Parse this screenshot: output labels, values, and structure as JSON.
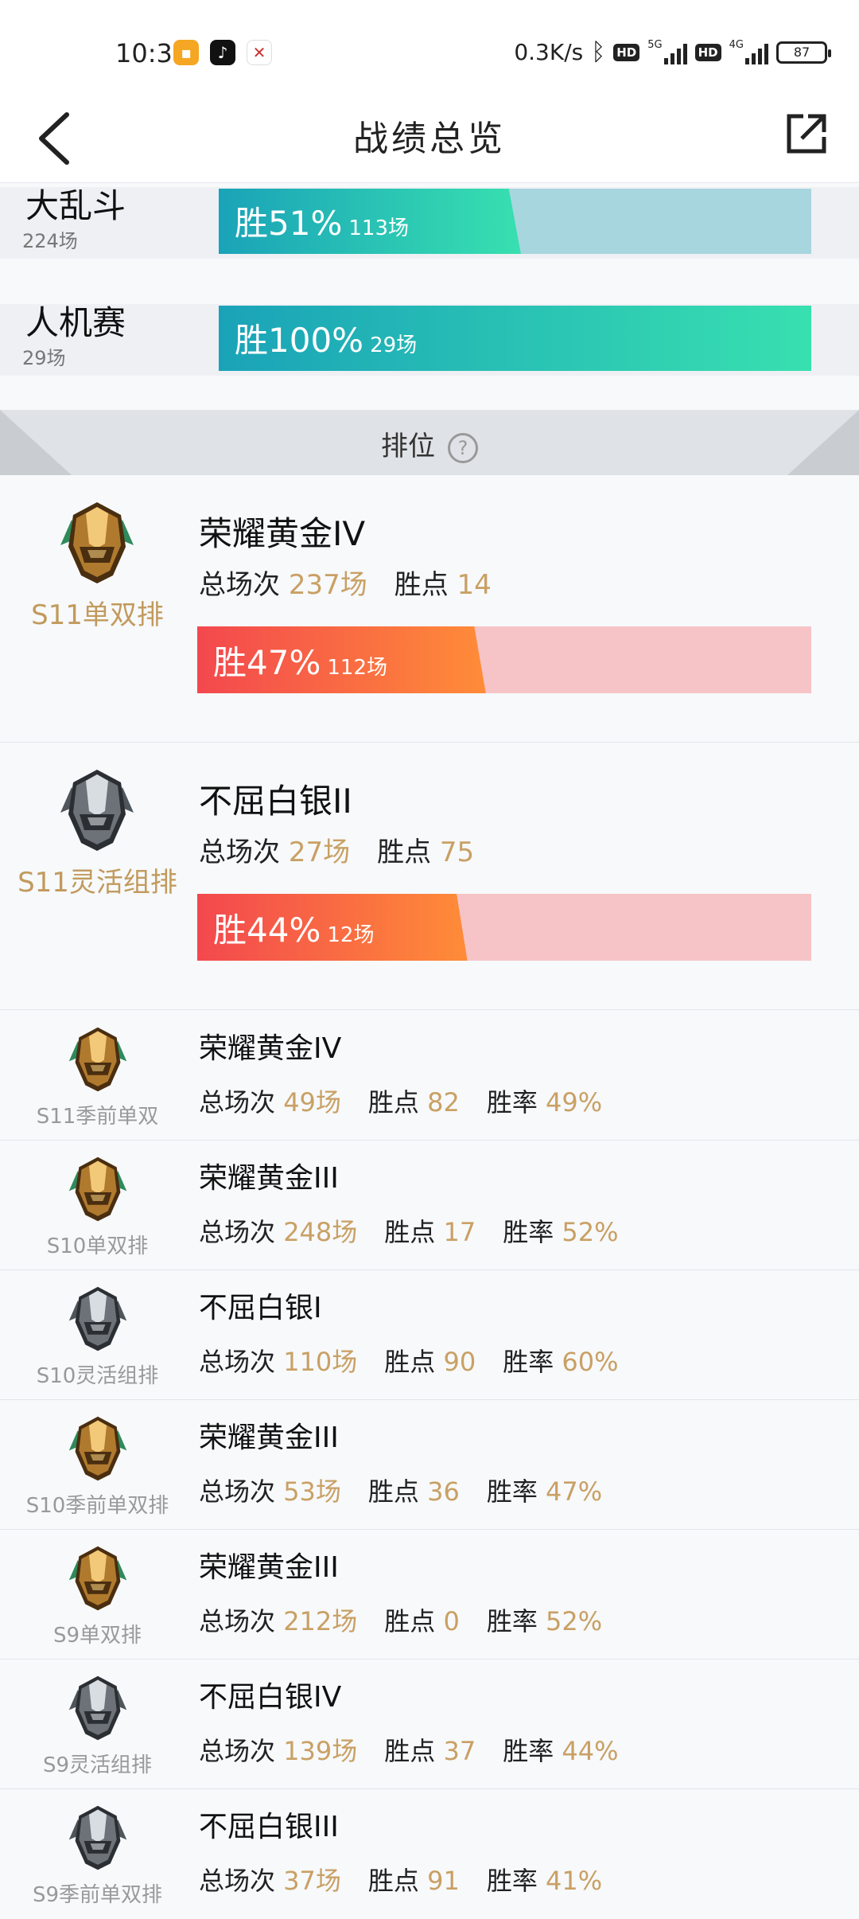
{
  "status_bar": {
    "time": "10:39",
    "network_speed": "0.3K/s",
    "hd1": "HD",
    "hd2": "HD",
    "sig1_label": "5G",
    "sig2_label": "4G",
    "battery": "87"
  },
  "nav": {
    "title": "战绩总览"
  },
  "modes": [
    {
      "name": "大乱斗",
      "count": "224场",
      "win_text": "胜51%",
      "win_games": "113场",
      "win_rate": 0.51
    },
    {
      "name": "人机赛",
      "count": "29场",
      "win_text": "胜100%",
      "win_games": "29场",
      "win_rate": 1.0
    }
  ],
  "rank_header": {
    "label": "排位",
    "help": "?"
  },
  "big_ranks": [
    {
      "season": "S11单双排",
      "tier": "荣耀黄金IV",
      "total_label": "总场次",
      "total": "237场",
      "points_label": "胜点",
      "points": "14",
      "win_text": "胜47%",
      "win_games": "112场",
      "win_rate": 0.47,
      "emblem": "gold"
    },
    {
      "season": "S11灵活组排",
      "tier": "不屈白银II",
      "total_label": "总场次",
      "total": "27场",
      "points_label": "胜点",
      "points": "75",
      "win_text": "胜44%",
      "win_games": "12场",
      "win_rate": 0.44,
      "emblem": "silver"
    }
  ],
  "small_ranks": [
    {
      "season": "S11季前单双",
      "tier": "荣耀黄金IV",
      "total_label": "总场次",
      "total": "49场",
      "points_label": "胜点",
      "points": "82",
      "rate_label": "胜率",
      "rate": "49%",
      "emblem": "gold"
    },
    {
      "season": "S10单双排",
      "tier": "荣耀黄金III",
      "total_label": "总场次",
      "total": "248场",
      "points_label": "胜点",
      "points": "17",
      "rate_label": "胜率",
      "rate": "52%",
      "emblem": "gold"
    },
    {
      "season": "S10灵活组排",
      "tier": "不屈白银I",
      "total_label": "总场次",
      "total": "110场",
      "points_label": "胜点",
      "points": "90",
      "rate_label": "胜率",
      "rate": "60%",
      "emblem": "silver"
    },
    {
      "season": "S10季前单双排",
      "tier": "荣耀黄金III",
      "total_label": "总场次",
      "total": "53场",
      "points_label": "胜点",
      "points": "36",
      "rate_label": "胜率",
      "rate": "47%",
      "emblem": "gold"
    },
    {
      "season": "S9单双排",
      "tier": "荣耀黄金III",
      "total_label": "总场次",
      "total": "212场",
      "points_label": "胜点",
      "points": "0",
      "rate_label": "胜率",
      "rate": "52%",
      "emblem": "gold"
    },
    {
      "season": "S9灵活组排",
      "tier": "不屈白银IV",
      "total_label": "总场次",
      "total": "139场",
      "points_label": "胜点",
      "points": "37",
      "rate_label": "胜率",
      "rate": "44%",
      "emblem": "silver"
    },
    {
      "season": "S9季前单双排",
      "tier": "不屈白银III",
      "total_label": "总场次",
      "total": "37场",
      "points_label": "胜点",
      "points": "91",
      "rate_label": "胜率",
      "rate": "41%",
      "emblem": "silver"
    }
  ],
  "colors": {
    "accent_gold": "#c9a064",
    "teal_start": "#1aa3b8",
    "teal_end": "#38e0b0",
    "red_start": "#f3484e",
    "red_end": "#ff8c38"
  }
}
